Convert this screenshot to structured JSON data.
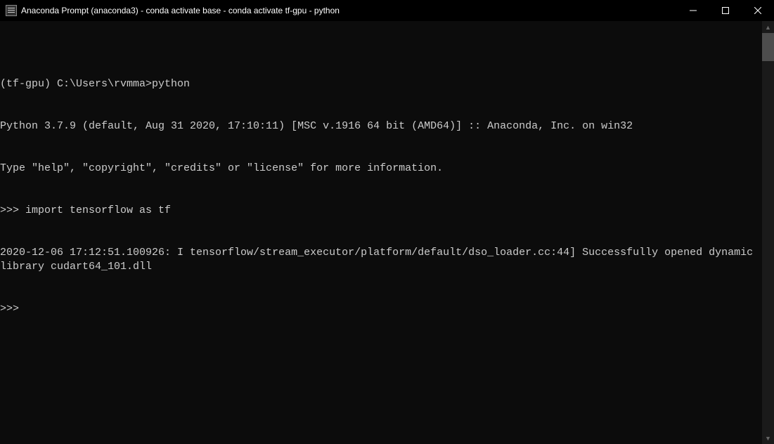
{
  "window": {
    "title": "Anaconda Prompt (anaconda3) - conda  activate base - conda  activate tf-gpu - python"
  },
  "terminal": {
    "lines": [
      "",
      "(tf-gpu) C:\\Users\\rvmma>python",
      "Python 3.7.9 (default, Aug 31 2020, 17:10:11) [MSC v.1916 64 bit (AMD64)] :: Anaconda, Inc. on win32",
      "Type \"help\", \"copyright\", \"credits\" or \"license\" for more information.",
      ">>> import tensorflow as tf",
      "2020-12-06 17:12:51.100926: I tensorflow/stream_executor/platform/default/dso_loader.cc:44] Successfully opened dynamic library cudart64_101.dll",
      ">>>"
    ]
  }
}
